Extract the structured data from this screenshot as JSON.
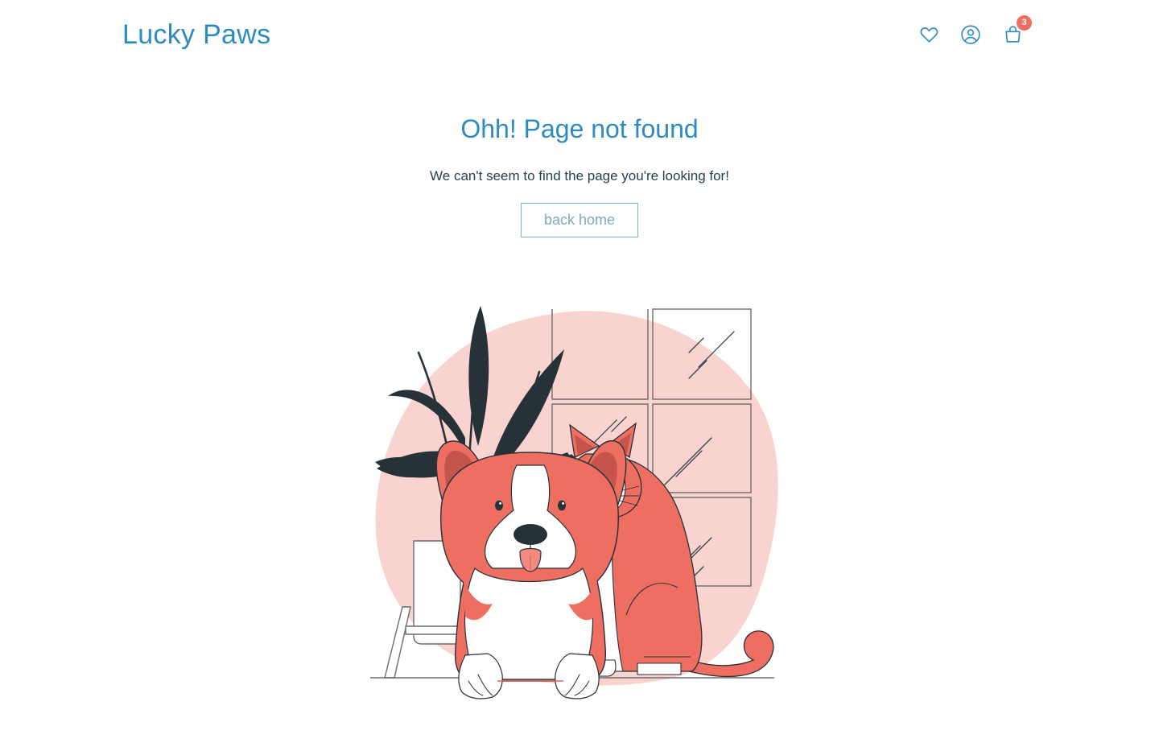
{
  "header": {
    "brand": "Lucky Paws",
    "actions": [
      {
        "name": "wishlist",
        "icon": "heart-icon",
        "label": "Wishlist"
      },
      {
        "name": "account",
        "icon": "user-circle-icon",
        "label": "Account"
      },
      {
        "name": "cart",
        "icon": "shopping-bag-icon",
        "label": "Cart",
        "badge": "3"
      }
    ]
  },
  "main": {
    "title": "Ohh! Page not found",
    "subtitle": "We can't seem to find the page you're looking for!",
    "back_home_label": "back home",
    "illustration": {
      "name": "dog-and-cat-by-window-illustration",
      "alt": "A corgi dog and a cat sitting in front of a window next to a potted plant"
    }
  },
  "colors": {
    "brand_blue": "#2e8bc0",
    "button_border": "#6fb3d4",
    "button_text": "#7ca9c0",
    "text_dark": "#26404f",
    "accent_coral": "#ee6e62",
    "accent_coral_dark": "#c4544c",
    "blob_pink": "#f9d3d0",
    "ink_navy": "#263238",
    "outline_gray": "#5a5a5a",
    "white": "#ffffff"
  }
}
